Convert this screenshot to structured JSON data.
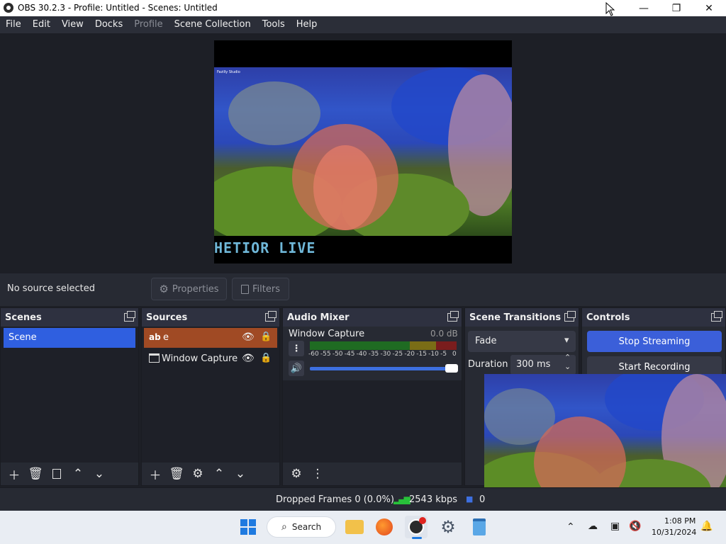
{
  "window": {
    "title": "OBS 30.2.3 - Profile: Untitled - Scenes: Untitled",
    "minimize": "—",
    "maximize": "❐",
    "close": "✕"
  },
  "menubar": {
    "items": [
      "File",
      "Edit",
      "View",
      "Docks",
      "Profile",
      "Scene Collection",
      "Tools",
      "Help"
    ],
    "disabled": [
      "Profile"
    ]
  },
  "preview": {
    "overlay_text": "HETIOR LIVE",
    "watermark": "Fazilly Studio"
  },
  "context_bar": {
    "no_source": "No source selected",
    "properties_label": "Properties",
    "filters_label": "Filters"
  },
  "scenes": {
    "title": "Scenes",
    "items": [
      "Scene"
    ],
    "selected_index": 0
  },
  "sources": {
    "title": "Sources",
    "items": [
      {
        "icon": "text-icon",
        "label": "e",
        "selected": true
      },
      {
        "icon": "window-icon",
        "label": "Window Capture",
        "selected": false
      }
    ]
  },
  "audio_mixer": {
    "title": "Audio Mixer",
    "channel_name": "Window Capture",
    "channel_level": "0.0 dB",
    "scale": [
      "-60",
      "-55",
      "-50",
      "-45",
      "-40",
      "-35",
      "-30",
      "-25",
      "-20",
      "-15",
      "-10",
      "-5",
      "0"
    ],
    "volume": 1.0
  },
  "scene_transitions": {
    "title": "Scene Transitions",
    "transition": "Fade",
    "duration_label": "Duration",
    "duration_value": "300 ms"
  },
  "controls": {
    "title": "Controls",
    "stop_streaming": "Stop Streaming",
    "start_recording": "Start Recording"
  },
  "status_bar": {
    "dropped_frames": "Dropped Frames 0 (0.0%)",
    "bitrate": "2543 kbps",
    "extra": "0"
  },
  "taskbar": {
    "search_label": "Search",
    "time": "1:08 PM",
    "date": "10/31/2024"
  },
  "colors": {
    "accent_blue": "#2f5fe0",
    "selected_source": "#a04a24",
    "dock_bg": "#272a33"
  }
}
